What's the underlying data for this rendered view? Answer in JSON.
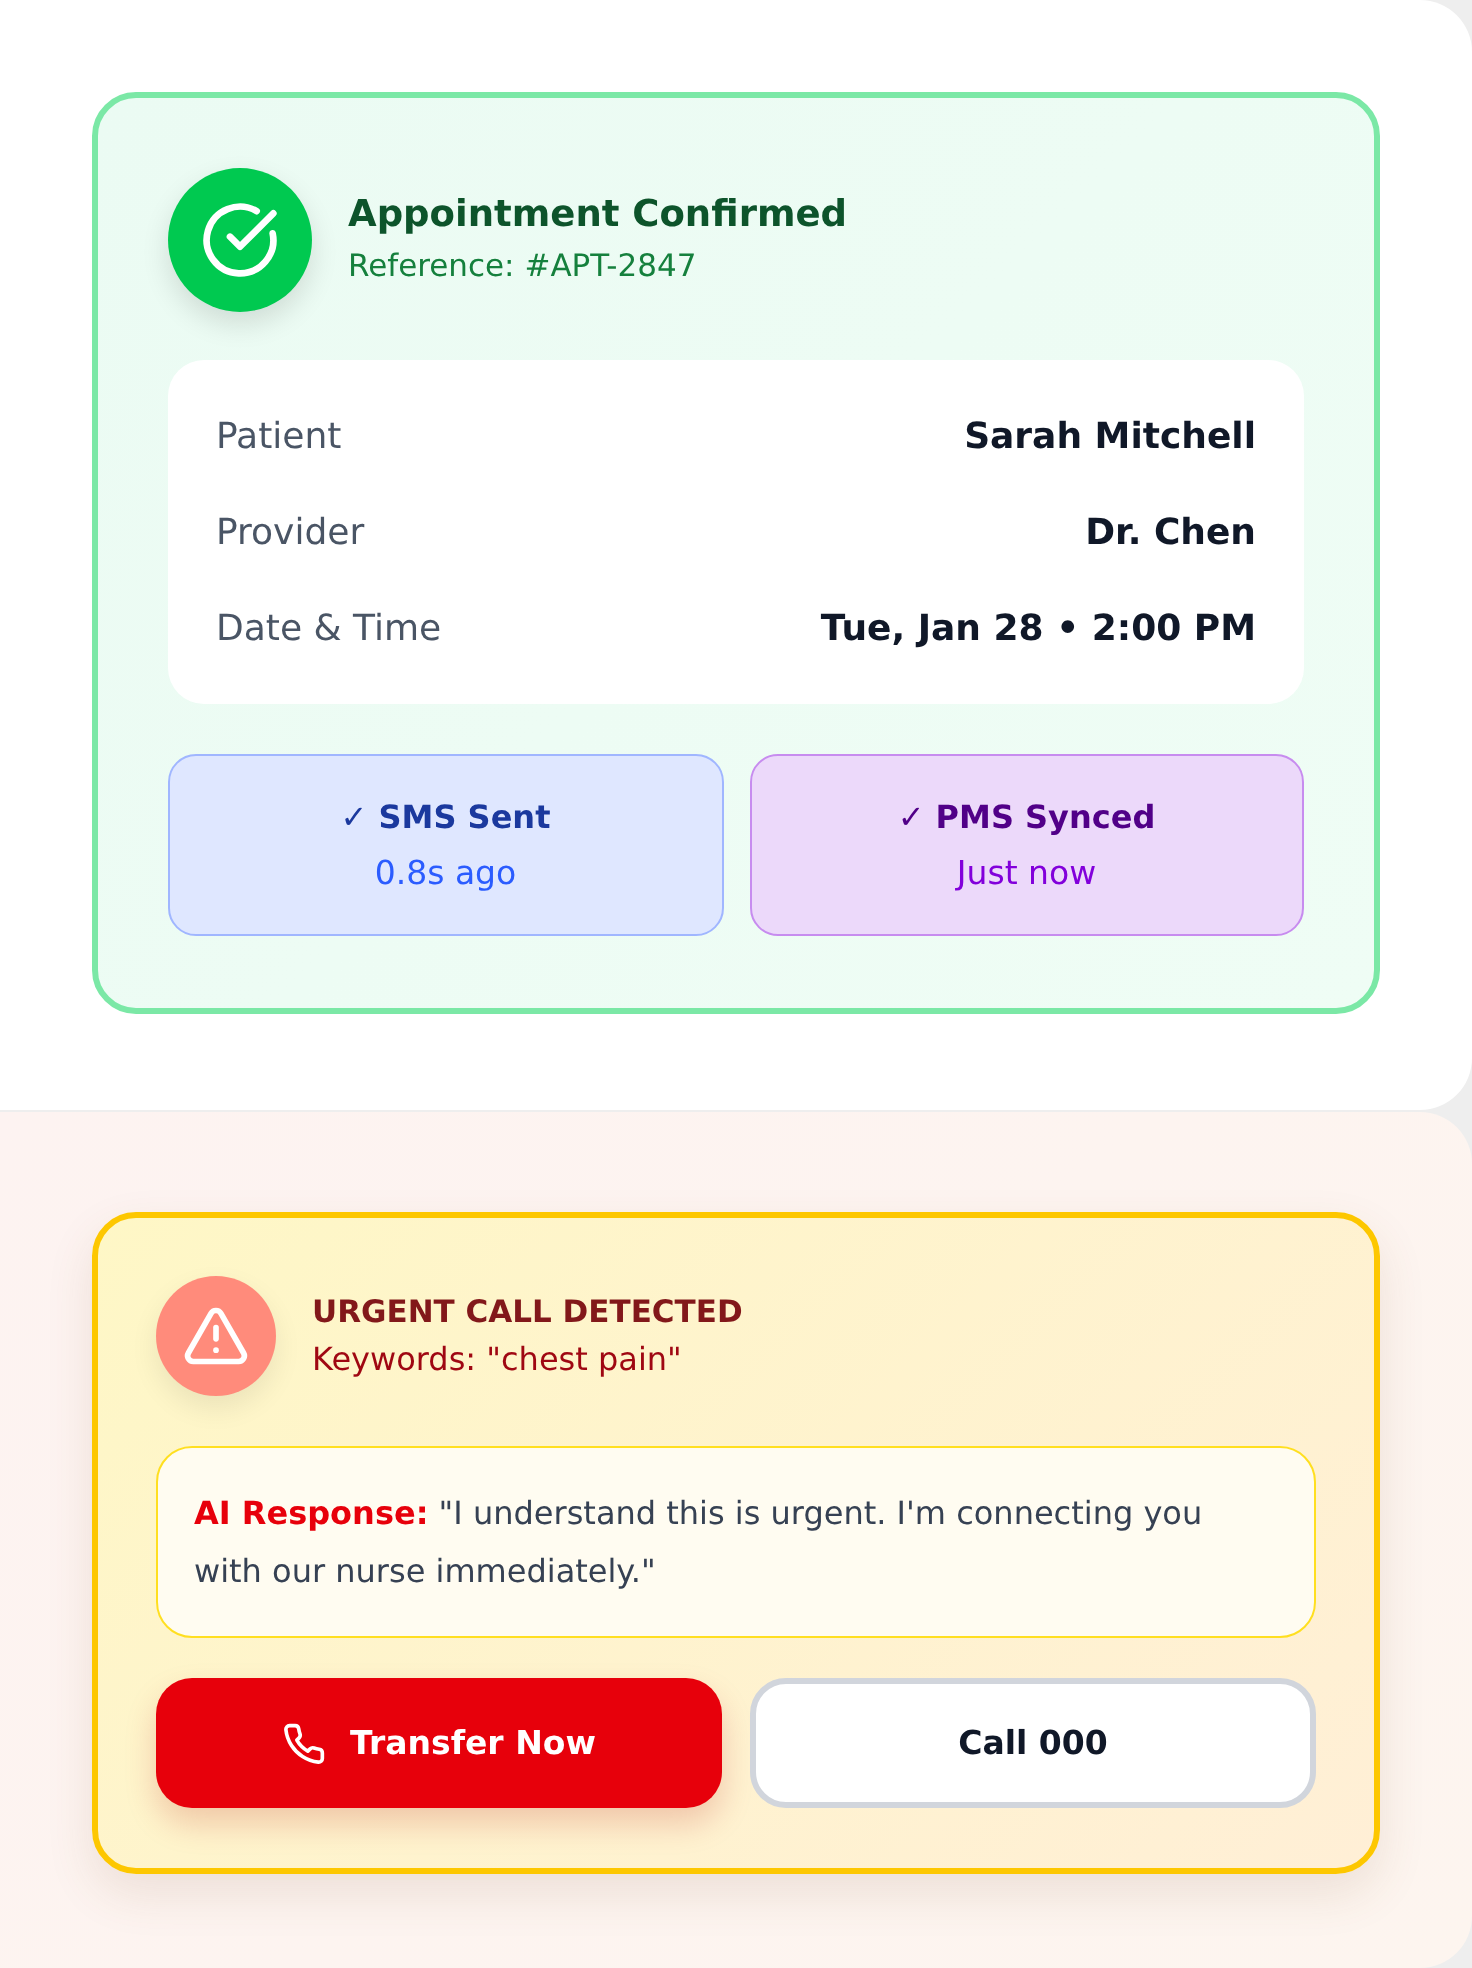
{
  "appointment_card": {
    "title": "Appointment Confirmed",
    "reference": "Reference: #APT-2847",
    "details": [
      {
        "label": "Patient",
        "value": "Sarah Mitchell"
      },
      {
        "label": "Provider",
        "value": "Dr. Chen"
      },
      {
        "label": "Date & Time",
        "value": "Tue, Jan 28 • 2:00 PM"
      }
    ],
    "statuses": [
      {
        "title": "✓ SMS Sent",
        "time": "0.8s ago",
        "color": "#2b5cff"
      },
      {
        "title": "✓ PMS Synced",
        "time": "Just now",
        "color": "#8200db"
      }
    ]
  },
  "urgent_card": {
    "title": "URGENT CALL DETECTED",
    "keywords": "Keywords: \"chest pain\"",
    "response": "**AI Response:** \"I understand this is urgent. I'm connecting you with our nurse immediately.\"",
    "buttons": [
      {
        "kind": "primary",
        "label": "Transfer Now"
      },
      {
        "kind": "secondary",
        "label": "Call 000"
      }
    ]
  }
}
